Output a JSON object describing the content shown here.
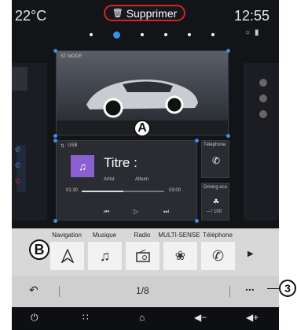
{
  "status": {
    "temperature": "22°C",
    "time": "12:55",
    "delete_button": "Supprimer",
    "page_dots": 6,
    "active_dot": 1
  },
  "widgets": {
    "mode": {
      "label": "ST MODE",
      "marker": "A"
    },
    "media": {
      "source": "USB",
      "title": "Titre :",
      "artist": "Artist",
      "album": "Album",
      "time_elapsed": "01:30",
      "time_total": "03:00",
      "progress": 0.5
    },
    "phone": {
      "label": "Téléphone"
    },
    "driving_eco": {
      "label": "Driving eco",
      "score": "-- / 100"
    }
  },
  "shortcuts": {
    "marker": "B",
    "items": [
      {
        "label": "Navigation",
        "icon": "navigation-icon"
      },
      {
        "label": "Musique",
        "icon": "music-icon"
      },
      {
        "label": "Radio",
        "icon": "radio-icon"
      },
      {
        "label": "MULTI-SENSE",
        "icon": "multi-sense-icon"
      },
      {
        "label": "Téléphone",
        "icon": "phone-icon"
      }
    ],
    "next_icon": "play-arrow-icon"
  },
  "pager": {
    "page": "1/8",
    "back_icon": "back-icon",
    "more": "...",
    "callout": "3"
  },
  "nav_bar": [
    "power-icon",
    "apps-icon",
    "home-icon",
    "volume-down-icon",
    "volume-up-icon"
  ],
  "colors": {
    "accent": "#3a8ee6",
    "delete_border": "#d2232a"
  }
}
